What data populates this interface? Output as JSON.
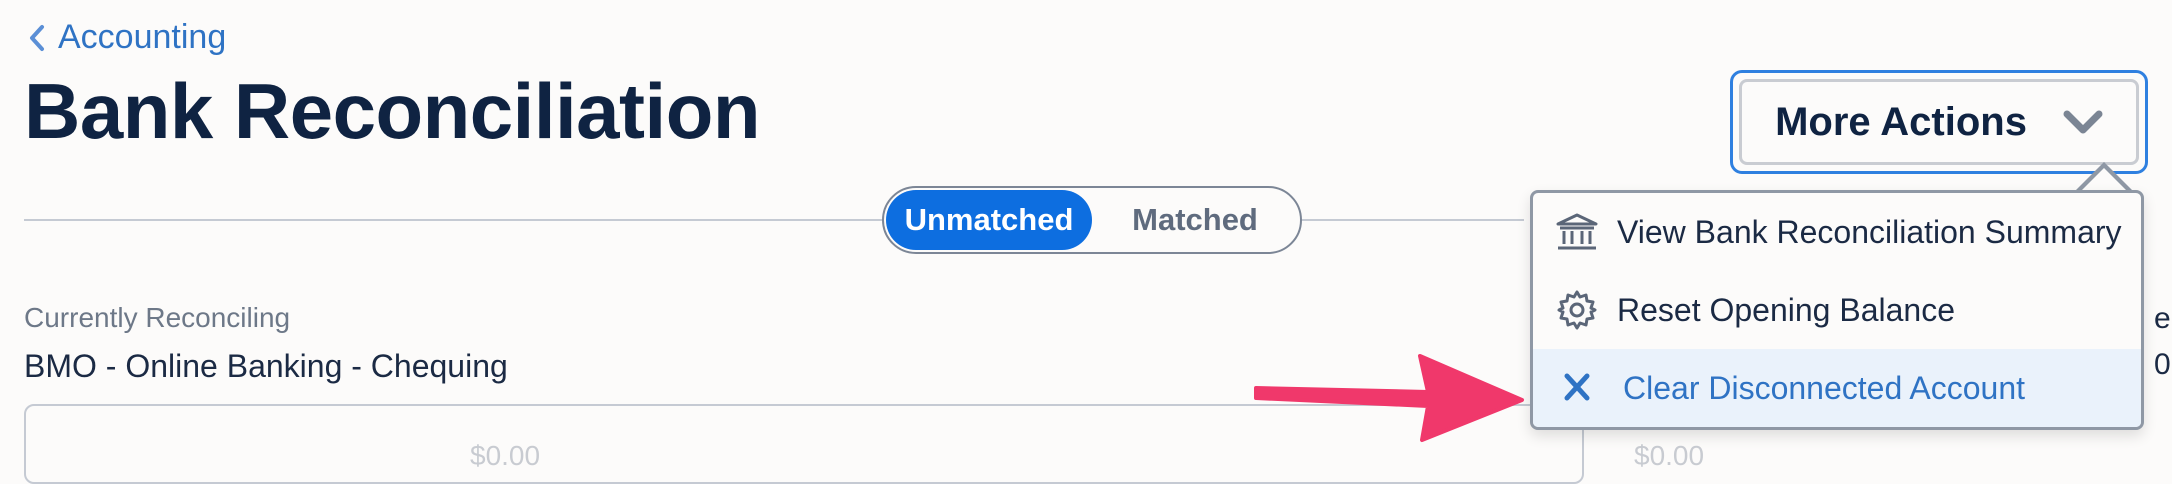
{
  "breadcrumb": {
    "back_label": "Accounting"
  },
  "page": {
    "title": "Bank Reconciliation"
  },
  "header": {
    "more_actions_label": "More Actions"
  },
  "tabs": [
    {
      "label": "Unmatched",
      "active": true
    },
    {
      "label": "Matched",
      "active": false
    }
  ],
  "reconciling": {
    "label": "Currently Reconciling",
    "account": "BMO - Online Banking - Chequing"
  },
  "edge_text": {
    "top": "e",
    "bottom": "0"
  },
  "panel": {
    "ghost_left": "$0.00",
    "ghost_right": "$0.00"
  },
  "menu": {
    "items": [
      {
        "label": "View Bank Reconciliation Summary",
        "icon": "bank-icon"
      },
      {
        "label": "Reset Opening Balance",
        "icon": "gear-icon"
      },
      {
        "label": "Clear Disconnected Account",
        "icon": "close-icon"
      }
    ]
  },
  "colors": {
    "accent": "#0d6ee0",
    "link": "#2f73c4",
    "annotation_arrow": "#f0386b"
  }
}
